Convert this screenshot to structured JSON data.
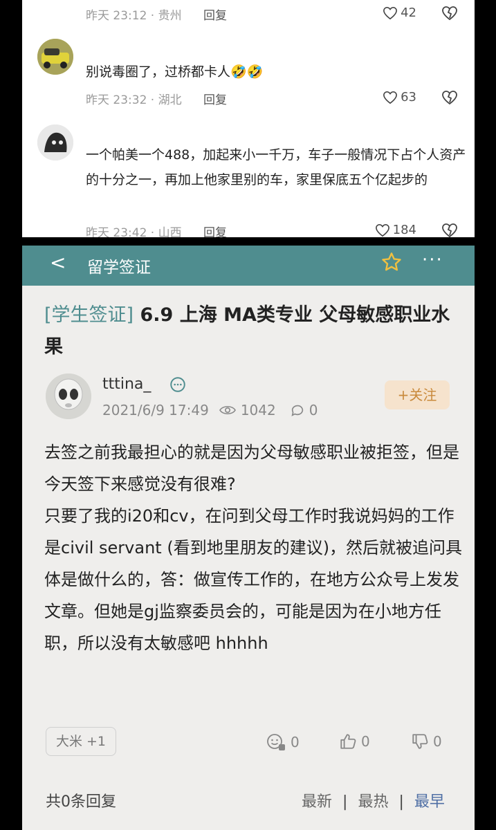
{
  "comments": [
    {
      "time": "昨天 23:12 · 贵州",
      "reply": "回复",
      "likes": "42"
    },
    {
      "text": "别说毒圈了，过桥都卡人🤣🤣",
      "time": "昨天 23:32 · 湖北",
      "reply": "回复",
      "likes": "63"
    },
    {
      "text": "一个帕美一个488，加起来小一千万，车子一般情况下占个人资产的十分之一，再加上他家里别的车，家里保底五个亿起步的",
      "time": "昨天 23:42 · 山西",
      "reply": "回复",
      "likes": "184"
    }
  ],
  "app": {
    "header": {
      "back": "<",
      "title": "留学签证",
      "more": "···"
    },
    "post": {
      "tag": "[学生签证]",
      "title": "6.9 上海 MA类专业 父母敏感职业水果",
      "author": "tttina_",
      "date": "2021/6/9 17:49",
      "views": "1042",
      "comments": "0",
      "follow": "+关注",
      "body": [
        "去签之前我最担心的就是因为父母敏感职业被拒签，但是今天签下来感觉没有很难?",
        "只要了我的i20和cv，在问到父母工作时我说妈妈的工作是civil servant (看到地里朋友的建议)，然后就被追问具体是做什么的，答：做宣传工作的，在地方公众号上发发文章。但她是gj监察委员会的，可能是因为在小地方任职，所以没有太敏感吧 hhhhh"
      ],
      "award": "大米 +1",
      "reactions": {
        "emoji": "0",
        "up": "0",
        "down": "0"
      }
    },
    "footer": {
      "reply_count": "共0条回复",
      "sort_newest": "最新",
      "sort_hot": "最热",
      "sort_earliest": "最早",
      "sep": "|"
    }
  },
  "colors": {
    "header_bg": "#4f8d8f",
    "follow_bg": "#f6e3cd",
    "follow_text": "#c98a3c",
    "active_sort": "#4f6fa5"
  }
}
